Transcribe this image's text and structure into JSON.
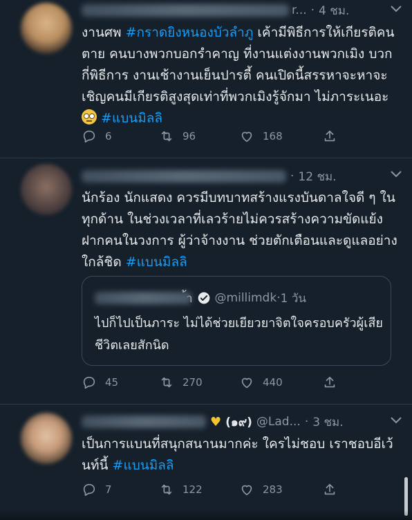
{
  "tweets": [
    {
      "time": "4 ชม.",
      "name_tail": "r...",
      "body_parts": [
        {
          "t": "งานศพ ",
          "tag": false
        },
        {
          "t": "#กราดยิงหนองบัวลำภู",
          "tag": true
        },
        {
          "t": " เค้ามีพิธีการให้เกียรติคนตาย คนบางพวกบอกรำคาญ ที่งานแต่งงานพวกเมิง บวกกี่พิธีการ งานเช้างานเย็นปารตี้ คนเปิดนี้สรรหาจะหาจะเชิญคนมีเกียรติสูงสุดเท่าที่พวกเมิงรู้จักมา ไม่ภาระเนอะ",
          "tag": false
        },
        {
          "t": "#แบนมิลลิ",
          "tag": true
        }
      ],
      "replies": "6",
      "retweets": "96",
      "likes": "168"
    },
    {
      "time": "12 ชม.",
      "body_parts": [
        {
          "t": "นักร้อง นักแสดง ควรมีบทบาทสร้างแรงบันดาลใจดี ๆ ในทุกด้าน ในช่วงเวลาที่เลวร้ายไม่ควรสร้างความขัดแย้ง ฝากคนในวงการ ผู้ว่าจ้างงาน ช่วยตักเตือนและดูแลอย่างใกล้ชิด ",
          "tag": false
        },
        {
          "t": "#แบนมิลลิ",
          "tag": true
        }
      ],
      "quote": {
        "handle": "@millimdk",
        "time": "1 วัน",
        "name_suffix": "้า",
        "text": "ไปก็ไปเป็นภาระ ไม่ได้ช่วยเยียวยาจิตใจครอบครัวผู้เสียชีวิตเลยสักนิด"
      },
      "replies": "45",
      "retweets": "270",
      "likes": "440"
    },
    {
      "time": "3 ชม.",
      "handle": "@Lad...",
      "name_extra": "(๑๙)",
      "body_parts": [
        {
          "t": "เป็นการแบนที่สนุกสนานมากค่ะ ใครไม่ชอบ เราชอบอีเว้นท์นี้ ",
          "tag": false
        },
        {
          "t": "#แบนมิลลิ",
          "tag": true
        }
      ],
      "replies": "7",
      "retweets": "122",
      "likes": "283"
    }
  ],
  "icons": {
    "reply": "reply-icon",
    "retweet": "retweet-icon",
    "like": "like-icon",
    "share": "share-icon",
    "more": "chevron-down-icon",
    "verified": "verified-badge-icon",
    "heart_emoji": "yellow-heart-emoji",
    "face_emoji": "eye-roll-emoji"
  },
  "colors": {
    "background": "#15202b",
    "text": "#e7e9ea",
    "muted": "#8b98a5",
    "hashtag": "#1d9bf0"
  }
}
